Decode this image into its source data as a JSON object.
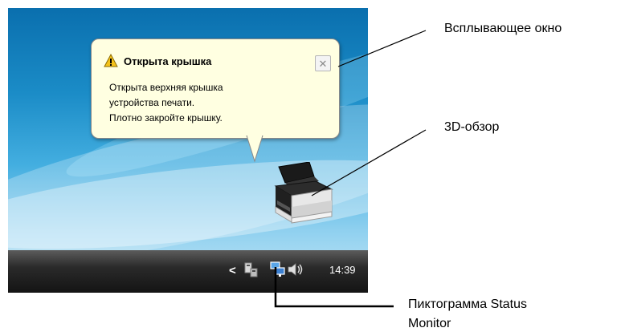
{
  "balloon": {
    "title": "Открыта крышка",
    "lines": [
      "Открыта верхняя крышка",
      "устройства печати.",
      "Плотно закройте крышку."
    ],
    "close_label": "✕",
    "warning_icon": "warning-icon"
  },
  "taskbar": {
    "time": "14:39",
    "arrow": "<",
    "icons": [
      "network-device-icon",
      "status-monitor-icon",
      "volume-icon"
    ]
  },
  "callouts": {
    "popup": "Всплывающее окно",
    "view3d": "3D-обзор",
    "status_icon_line1": "Пиктограмма Status",
    "status_icon_line2": "Monitor"
  },
  "colors": {
    "balloon_bg": "#ffffe1",
    "taskbar": "#1f1f1f",
    "desktop": "#1b8cc7"
  }
}
